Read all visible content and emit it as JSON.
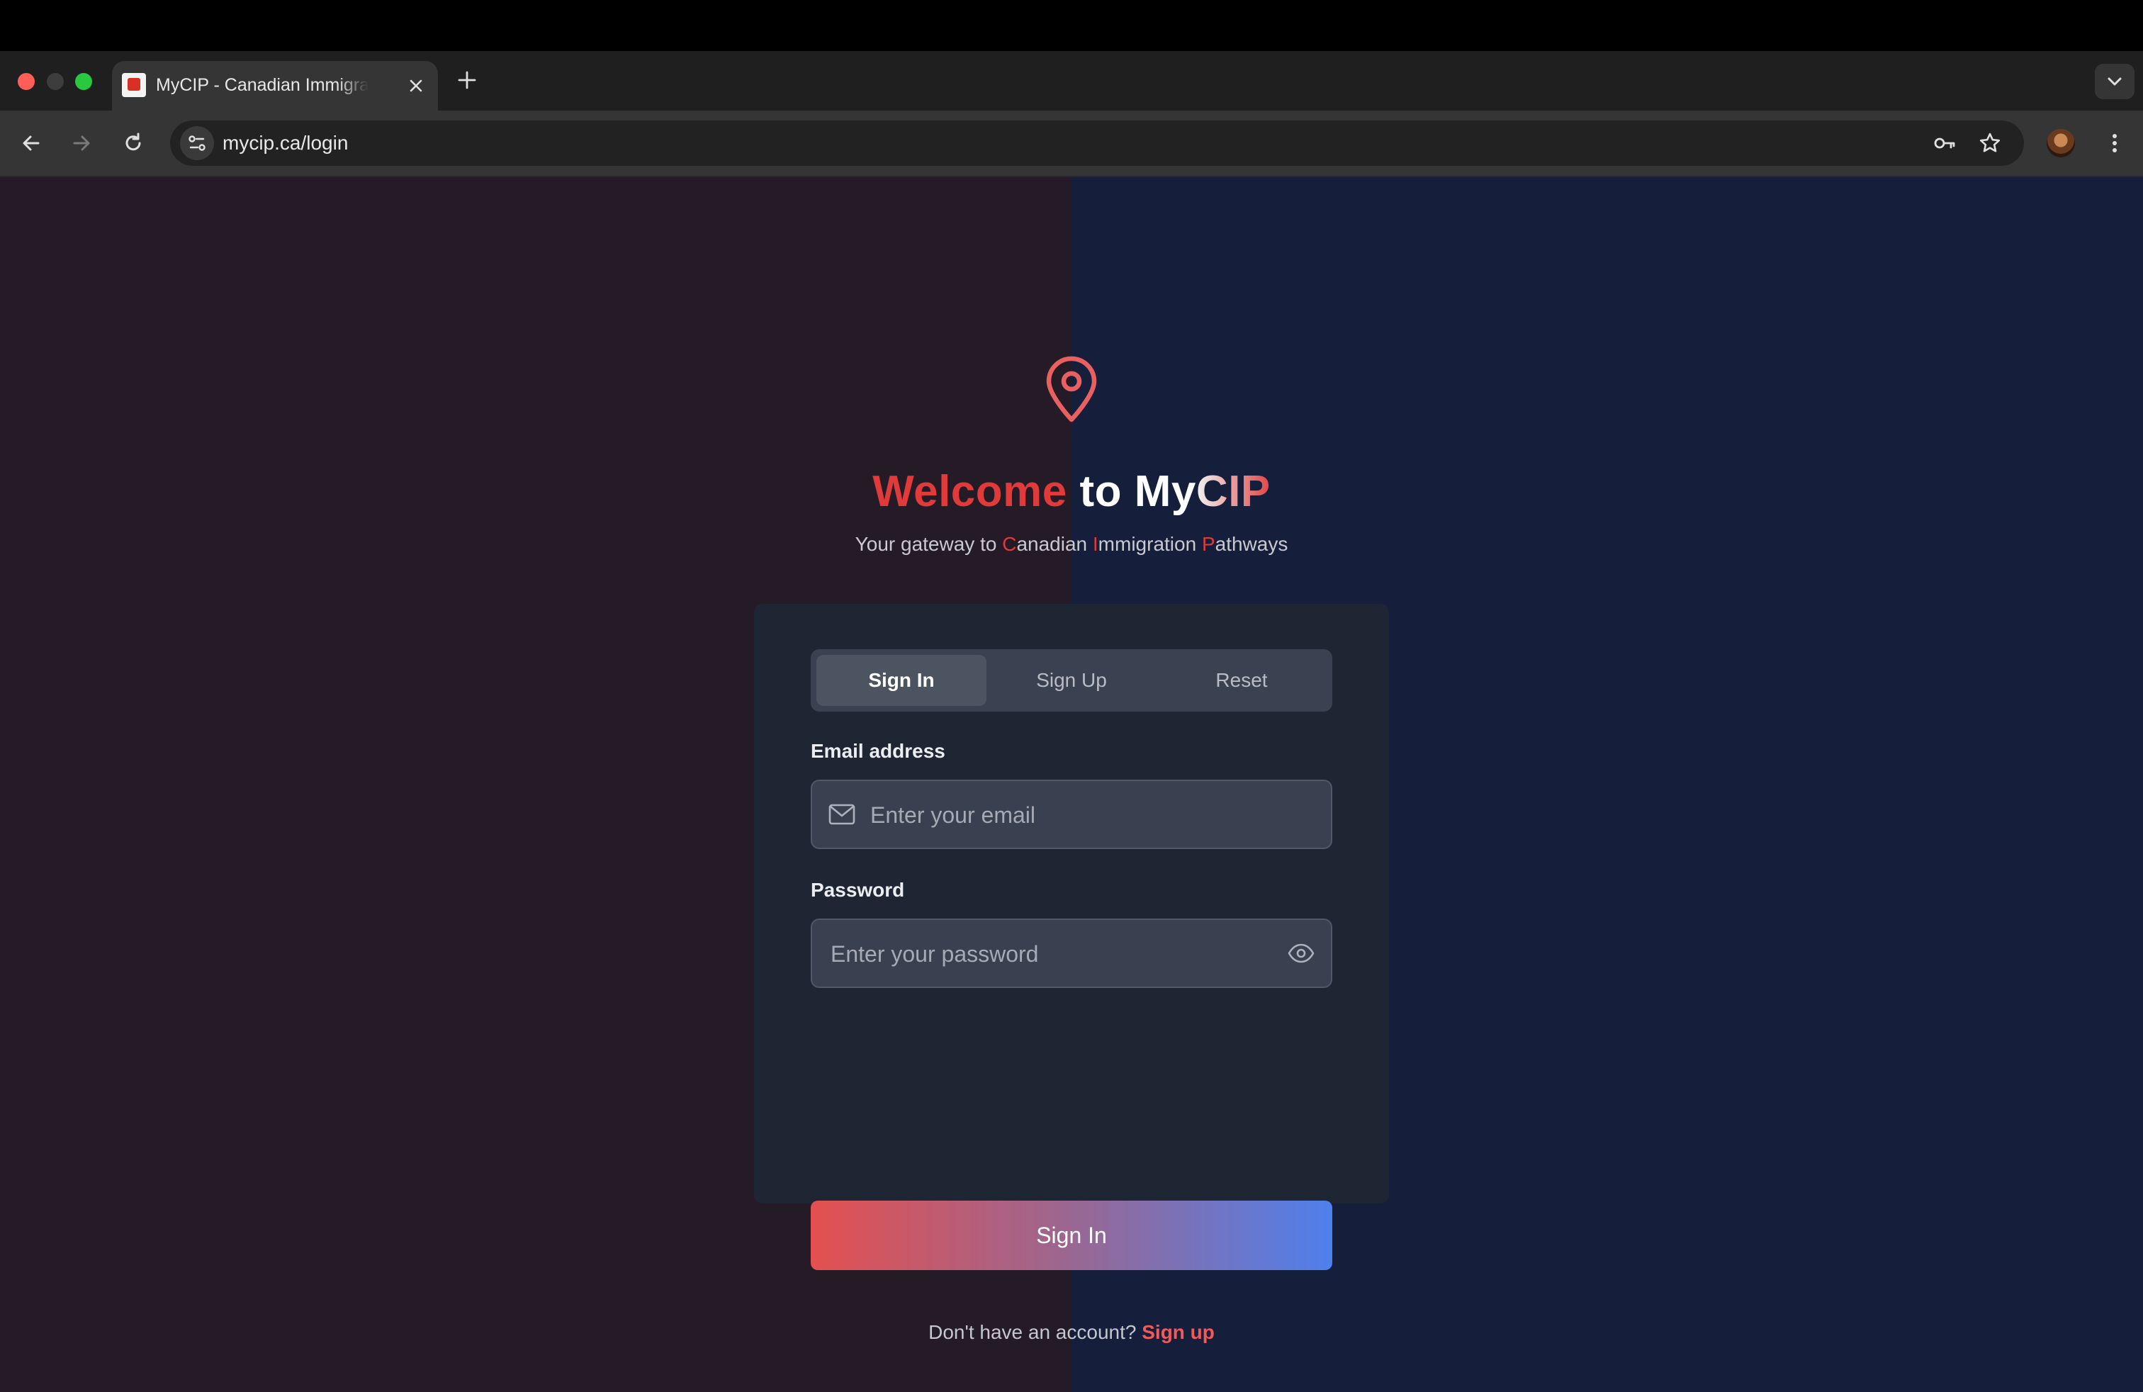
{
  "browser": {
    "tab_title": "MyCIP - Canadian Immigration Pathways",
    "url": "mycip.ca/login"
  },
  "hero": {
    "welcome_word": "Welcome",
    "to_word": "to",
    "my_word": "My",
    "cip_word": "CIP",
    "tagline": {
      "pre": "Your gateway to ",
      "c": "C",
      "c_rest": "anadian ",
      "i": "I",
      "i_rest": "mmigration ",
      "p": "P",
      "p_rest": "athways"
    }
  },
  "auth_tabs": {
    "sign_in": "Sign In",
    "sign_up": "Sign Up",
    "reset": "Reset",
    "active": "Sign In"
  },
  "form": {
    "email_label": "Email address",
    "email_placeholder": "Enter your email",
    "email_value": "",
    "password_label": "Password",
    "password_placeholder": "Enter your password",
    "password_value": "",
    "submit_label": "Sign In"
  },
  "footer": {
    "prompt": "Don't have an account?",
    "link": "Sign up"
  },
  "colors": {
    "accent_red": "#e03a3a",
    "accent_blue": "#4f80ec",
    "bg_left": "#251b26",
    "bg_right": "#151e3b",
    "card": "#1e2533"
  },
  "icons": [
    "close-icon",
    "plus-icon",
    "back-arrow-icon",
    "forward-arrow-icon",
    "reload-icon",
    "site-settings-icon",
    "key-icon",
    "star-icon",
    "more-vert-icon",
    "chevron-down-icon",
    "map-pin-icon",
    "mail-icon",
    "eye-icon"
  ]
}
